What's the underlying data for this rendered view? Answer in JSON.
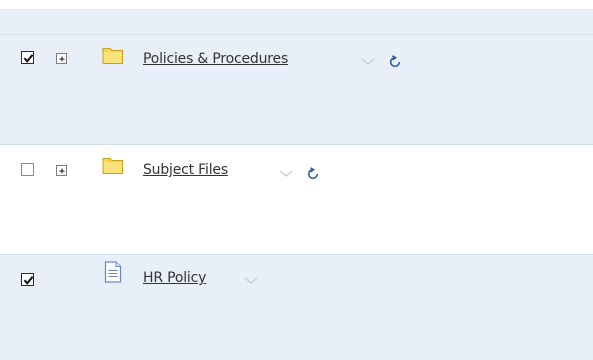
{
  "rows": [
    {
      "checked": true,
      "expandable": true,
      "icon": "folder-icon",
      "label": "Policies & Procedures",
      "menu_icon": "chevron-down-icon",
      "refresh_icon": "refresh-icon"
    },
    {
      "checked": false,
      "expandable": true,
      "icon": "folder-icon",
      "label": "Subject Files",
      "menu_icon": "chevron-down-icon",
      "refresh_icon": "refresh-icon"
    },
    {
      "checked": true,
      "expandable": false,
      "icon": "document-icon",
      "label": "HR Policy",
      "menu_icon": "chevron-down-icon"
    }
  ],
  "colors": {
    "row_alt": "#e8eff8",
    "row_plain": "#ffffff",
    "folder": "#f7d74a",
    "link_text": "#333333",
    "refresh": "#2f5f9a"
  }
}
